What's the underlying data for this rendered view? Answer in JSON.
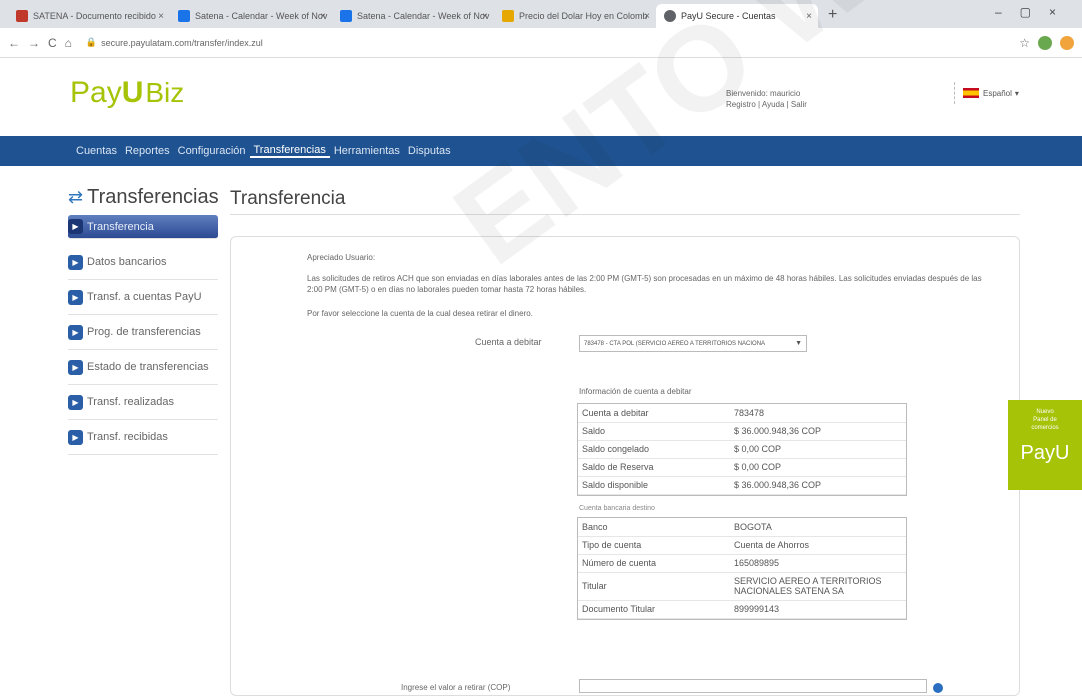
{
  "browser": {
    "tabs": [
      {
        "label": "SATENA - Documento recibido",
        "icon_color": "#c0392b",
        "active": false
      },
      {
        "label": "Satena - Calendar - Week of Nov",
        "icon_color": "#1a73e8",
        "active": false
      },
      {
        "label": "Satena - Calendar - Week of Nov",
        "icon_color": "#1a73e8",
        "active": false
      },
      {
        "label": "Precio del Dolar Hoy en Colomb",
        "icon_color": "#e6a700",
        "active": false
      },
      {
        "label": "PayU Secure - Cuentas",
        "icon_color": "#5f6368",
        "active": true
      }
    ],
    "new_tab": "+",
    "url": "secure.payulatam.com/transfer/index.zul"
  },
  "header": {
    "logo_pay": "Pay",
    "logo_u": "U",
    "logo_biz": "Biz",
    "welcome_line1": "Bienvenido: mauricio",
    "welcome_line2": "Registro | Ayuda | Salir",
    "language": "Español"
  },
  "menu": [
    {
      "label": "Cuentas",
      "active": false
    },
    {
      "label": "Reportes",
      "active": false
    },
    {
      "label": "Configuración",
      "active": false
    },
    {
      "label": "Transferencias",
      "active": true
    },
    {
      "label": "Herramientas",
      "active": false
    },
    {
      "label": "Disputas",
      "active": false
    }
  ],
  "sidebar": {
    "title": "Transferencias",
    "items": [
      {
        "label": "Transferencia",
        "active": true
      },
      {
        "label": "Datos bancarios",
        "active": false
      },
      {
        "label": "Transf. a cuentas PayU",
        "active": false
      },
      {
        "label": "Prog. de transferencias",
        "active": false
      },
      {
        "label": "Estado de transferencias",
        "active": false
      },
      {
        "label": "Transf. realizadas",
        "active": false
      },
      {
        "label": "Transf. recibidas",
        "active": false
      }
    ]
  },
  "main": {
    "title": "Transferencia",
    "greeting": "Apreciado Usuario:",
    "paragraph": "Las solicitudes de retiros ACH que son enviadas en días laborales antes de las 2:00 PM (GMT-5) son procesadas en un máximo de 48 horas hábiles. Las solicitudes enviadas después de las 2:00 PM (GMT-5) o en días no laborales pueden tomar hasta 72 horas hábiles.",
    "instruction": "Por favor seleccione la cuenta de la cual desea retirar el dinero.",
    "debit_label": "Cuenta a debitar",
    "debit_value": "783478 - CTA POL (SERVICIO AEREO A TERRITORIOS NACIONA",
    "info_title": "Información de cuenta a debitar",
    "account_rows": [
      {
        "key": "Cuenta a debitar",
        "value": "783478"
      },
      {
        "key": "Saldo",
        "value": "$ 36.000.948,36 COP"
      },
      {
        "key": "Saldo congelado",
        "value": "$ 0,00 COP"
      },
      {
        "key": "Saldo de Reserva",
        "value": "$ 0,00 COP"
      },
      {
        "key": "Saldo disponible",
        "value": "$ 36.000.948,36 COP"
      }
    ],
    "bank_caption": "Cuenta bancaria destino",
    "bank_rows": [
      {
        "key": "Banco",
        "value": "BOGOTA"
      },
      {
        "key": "Tipo de cuenta",
        "value": "Cuenta de Ahorros"
      },
      {
        "key": "Número de cuenta",
        "value": "165089895"
      },
      {
        "key": "Titular",
        "value": "SERVICIO AEREO A TERRITORIOS NACIONALES SATENA SA"
      },
      {
        "key": "Documento Titular",
        "value": "899999143"
      }
    ],
    "amount_label": "Ingrese el valor a retirar (COP)"
  },
  "promo": {
    "text_line1": "Nuevo",
    "text_line2": "Panel de",
    "text_line3": "comercios",
    "brand": "PayU"
  },
  "watermark": "ENTO WE",
  "colors": {
    "brand_green": "#a6c307",
    "menu_blue": "#1f5290",
    "accent_blue": "#2a5fa8"
  }
}
